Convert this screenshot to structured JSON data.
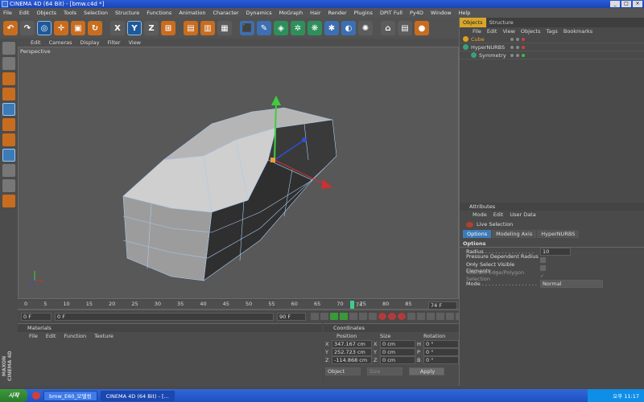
{
  "title_bar": {
    "title": "CINEMA 4D (64 Bit) - [bmw.c4d *]"
  },
  "menu": [
    "File",
    "Edit",
    "Objects",
    "Tools",
    "Selection",
    "Structure",
    "Functions",
    "Animation",
    "Character",
    "Dynamics",
    "MoGraph",
    "Hair",
    "Render",
    "Plugins",
    "DPIT Full",
    "Py4D",
    "Window",
    "Help"
  ],
  "viewport": {
    "menu": [
      "Edit",
      "Cameras",
      "Display",
      "Filter",
      "View"
    ],
    "label": "Perspective"
  },
  "timeline": {
    "ticks": [
      "0",
      "5",
      "10",
      "15",
      "20",
      "25",
      "30",
      "35",
      "40",
      "45",
      "50",
      "55",
      "60",
      "65",
      "70",
      "75",
      "80",
      "85",
      "90"
    ],
    "current_frame": "74",
    "end_label": "74 F",
    "start_field": "0 F",
    "min_field": "0 F",
    "max_field": "90 F",
    "end_field": "90 F"
  },
  "materials": {
    "title": "Materials",
    "menu": [
      "File",
      "Edit",
      "Function",
      "Texture"
    ]
  },
  "coordinates": {
    "title": "Coordinates",
    "headers": [
      "Position",
      "Size",
      "Rotation"
    ],
    "rows": [
      {
        "axis": "X",
        "pos": "347.167 cm",
        "size": "0 cm",
        "rot_axis": "H",
        "rot": "0 °"
      },
      {
        "axis": "Y",
        "pos": "252.723 cm",
        "size": "0 cm",
        "rot_axis": "P",
        "rot": "0 °"
      },
      {
        "axis": "Z",
        "pos": "-114.868 cm",
        "size": "0 cm",
        "rot_axis": "B",
        "rot": "0 °"
      }
    ],
    "mode": "Object",
    "size_mode": "Size",
    "apply": "Apply"
  },
  "objects": {
    "tabs": [
      "Objects",
      "Structure"
    ],
    "menu": [
      "File",
      "Edit",
      "View",
      "Objects",
      "Tags",
      "Bookmarks"
    ],
    "items": [
      {
        "name": "Cube"
      },
      {
        "name": "HyperNURBS"
      },
      {
        "name": "Symmetry"
      }
    ]
  },
  "attributes": {
    "title": "Attributes",
    "menu": [
      "Mode",
      "Edit",
      "User Data"
    ],
    "tool": "Live Selection",
    "tabs": [
      "Options",
      "Modeling Axis",
      "HyperNURBS"
    ],
    "section": "Options",
    "rows": [
      {
        "label": "Radius . . . . . . . . . . . . . . .",
        "value": "10"
      },
      {
        "label": "Pressure Dependent Radius . . .",
        "value": ""
      },
      {
        "label": "Only Select Visible Elements . .",
        "value": ""
      },
      {
        "label": "Tolerant Edge/Polygon Selection",
        "value": ""
      },
      {
        "label": "Mode . . . . . . . . . . . . . . . . .",
        "value": "Normal"
      }
    ]
  },
  "taskbar": {
    "start": "시작",
    "tasks": [
      "bmw_E60_모델링",
      "CINEMA 4D (64 Bit) - [..."
    ],
    "clock": "오후 11:17"
  },
  "logo": "MAXON CINEMA 4D",
  "colors": {
    "accent": "#c86d1f",
    "selection_blue": "#3d7ab8",
    "tab_gold": "#d7a62a"
  }
}
